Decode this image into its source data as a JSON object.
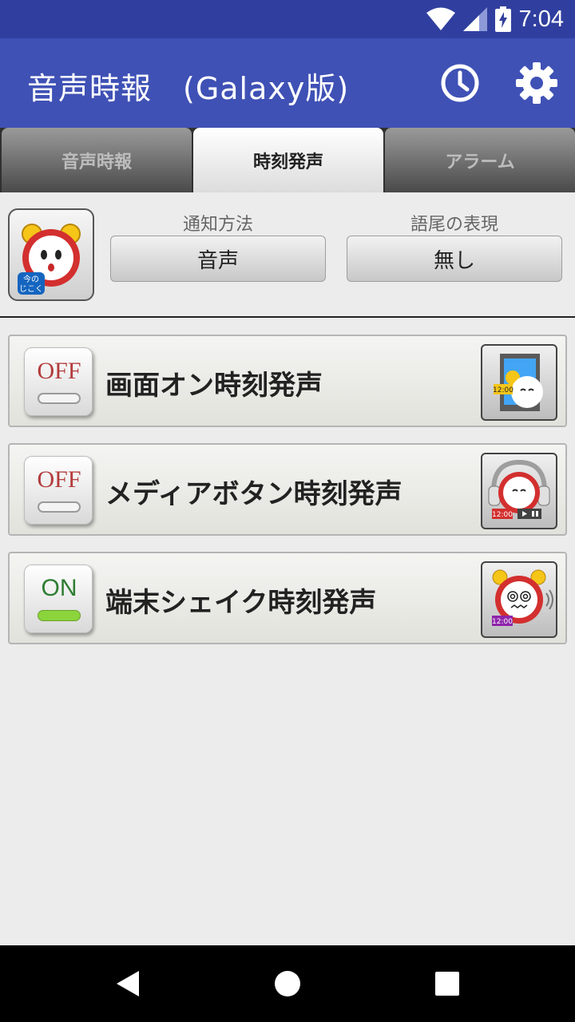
{
  "status_bar": {
    "time": "7:04",
    "icons": [
      "wifi-icon",
      "signal-icon",
      "battery-charging-icon"
    ]
  },
  "app_bar": {
    "title": "音声時報　(Galaxy版)",
    "actions": [
      "history-clock-icon",
      "gear-icon"
    ]
  },
  "tabs": [
    {
      "label": "音声時報",
      "selected": false
    },
    {
      "label": "時刻発声",
      "selected": true
    },
    {
      "label": "アラーム",
      "selected": false
    }
  ],
  "settings": {
    "mascot_badge": "今の じこく",
    "notify_method": {
      "label": "通知方法",
      "value": "音声"
    },
    "ending_expression": {
      "label": "語尾の表現",
      "value": "無し"
    }
  },
  "features": [
    {
      "toggle": "OFF",
      "on": false,
      "title": "画面オン時刻発声",
      "icon": "screen-on-clock-icon",
      "icon_time": "12:00"
    },
    {
      "toggle": "OFF",
      "on": false,
      "title": "メディアボタン時刻発声",
      "icon": "headphone-clock-icon",
      "icon_time": "12:00"
    },
    {
      "toggle": "ON",
      "on": true,
      "title": "端末シェイク時刻発声",
      "icon": "shake-clock-icon",
      "icon_time": "12:00"
    }
  ],
  "colors": {
    "status_bar": "#303f9f",
    "app_bar": "#3f51b5",
    "background": "#ececec",
    "toggle_on": "#8bd43c",
    "toggle_off_text": "#b23b3b"
  },
  "nav_bar": {
    "buttons": [
      "back-icon",
      "home-icon",
      "recents-icon"
    ]
  }
}
